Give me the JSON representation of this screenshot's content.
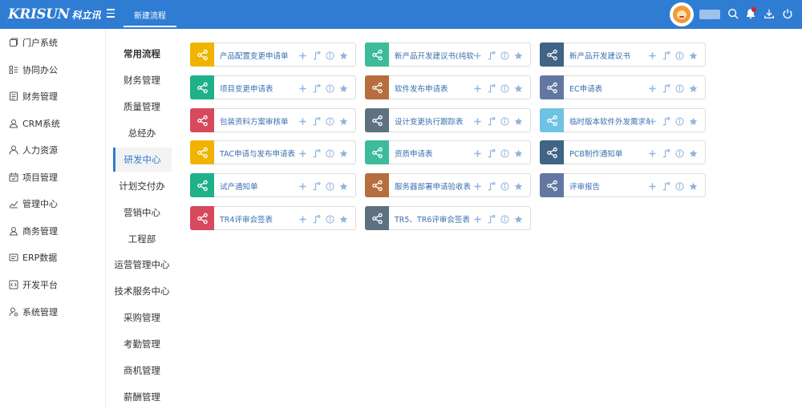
{
  "header": {
    "logo_text": "KRISUN",
    "logo_cn": "科立讯",
    "tab_label": "新建流程",
    "icons": [
      "menu-icon",
      "search-icon",
      "bell-icon",
      "download-icon",
      "power-icon"
    ]
  },
  "sidebar": {
    "items": [
      {
        "label": "门户系统",
        "icon": "portal-icon"
      },
      {
        "label": "协同办公",
        "icon": "office-icon"
      },
      {
        "label": "财务管理",
        "icon": "finance-icon"
      },
      {
        "label": "CRM系统",
        "icon": "crm-icon"
      },
      {
        "label": "人力资源",
        "icon": "user-icon"
      },
      {
        "label": "项目管理",
        "icon": "calendar-icon"
      },
      {
        "label": "管理中心",
        "icon": "chart-icon"
      },
      {
        "label": "商务管理",
        "icon": "business-icon"
      },
      {
        "label": "ERP数据",
        "icon": "erp-icon"
      },
      {
        "label": "开发平台",
        "icon": "code-icon"
      },
      {
        "label": "系统管理",
        "icon": "settings-user-icon"
      }
    ]
  },
  "categories": {
    "items": [
      {
        "label": "常用流程"
      },
      {
        "label": "财务管理"
      },
      {
        "label": "质量管理"
      },
      {
        "label": "总经办"
      },
      {
        "label": "研发中心"
      },
      {
        "label": "计划交付办"
      },
      {
        "label": "营销中心"
      },
      {
        "label": "工程部"
      },
      {
        "label": "运营管理中心"
      },
      {
        "label": "技术服务中心"
      },
      {
        "label": "采购管理"
      },
      {
        "label": "考勤管理"
      },
      {
        "label": "商机管理"
      },
      {
        "label": "薪酬管理"
      }
    ],
    "active": "研发中心"
  },
  "colors": {
    "header": "#2f7cd3",
    "yellow": "#f0b400",
    "teal": "#3dbb9b",
    "green": "#1fb189",
    "navy": "#3f6485",
    "brown": "#b66e3e",
    "slate": "#6378a0",
    "red": "#d74a5b",
    "grayblue": "#5d7181",
    "sky": "#6ec3e4"
  },
  "cards": [
    {
      "name": "产品配置变更申请单",
      "color": "yellow"
    },
    {
      "name": "新产品开发建议书(纯软件类)",
      "color": "teal"
    },
    {
      "name": "新产品开发建议书",
      "color": "navy"
    },
    {
      "name": "项目变更申请表",
      "color": "green"
    },
    {
      "name": "软件发布申请表",
      "color": "brown"
    },
    {
      "name": "EC申请表",
      "color": "slate"
    },
    {
      "name": "包装资料方案审核单",
      "color": "red"
    },
    {
      "name": "设计变更执行跟踪表",
      "color": "grayblue"
    },
    {
      "name": "临时版本软件外发需求单",
      "color": "sky"
    },
    {
      "name": "TAC申请与发布申请表",
      "color": "yellow"
    },
    {
      "name": "资质申请表",
      "color": "teal"
    },
    {
      "name": "PCB制作通知单",
      "color": "navy"
    },
    {
      "name": "试产通知单",
      "color": "green"
    },
    {
      "name": "服务器部署申请验收表",
      "color": "brown"
    },
    {
      "name": "评审报告",
      "color": "slate"
    },
    {
      "name": "TR4评审会签表",
      "color": "red"
    },
    {
      "name": "TR5、TR6评审会签表",
      "color": "grayblue"
    }
  ]
}
